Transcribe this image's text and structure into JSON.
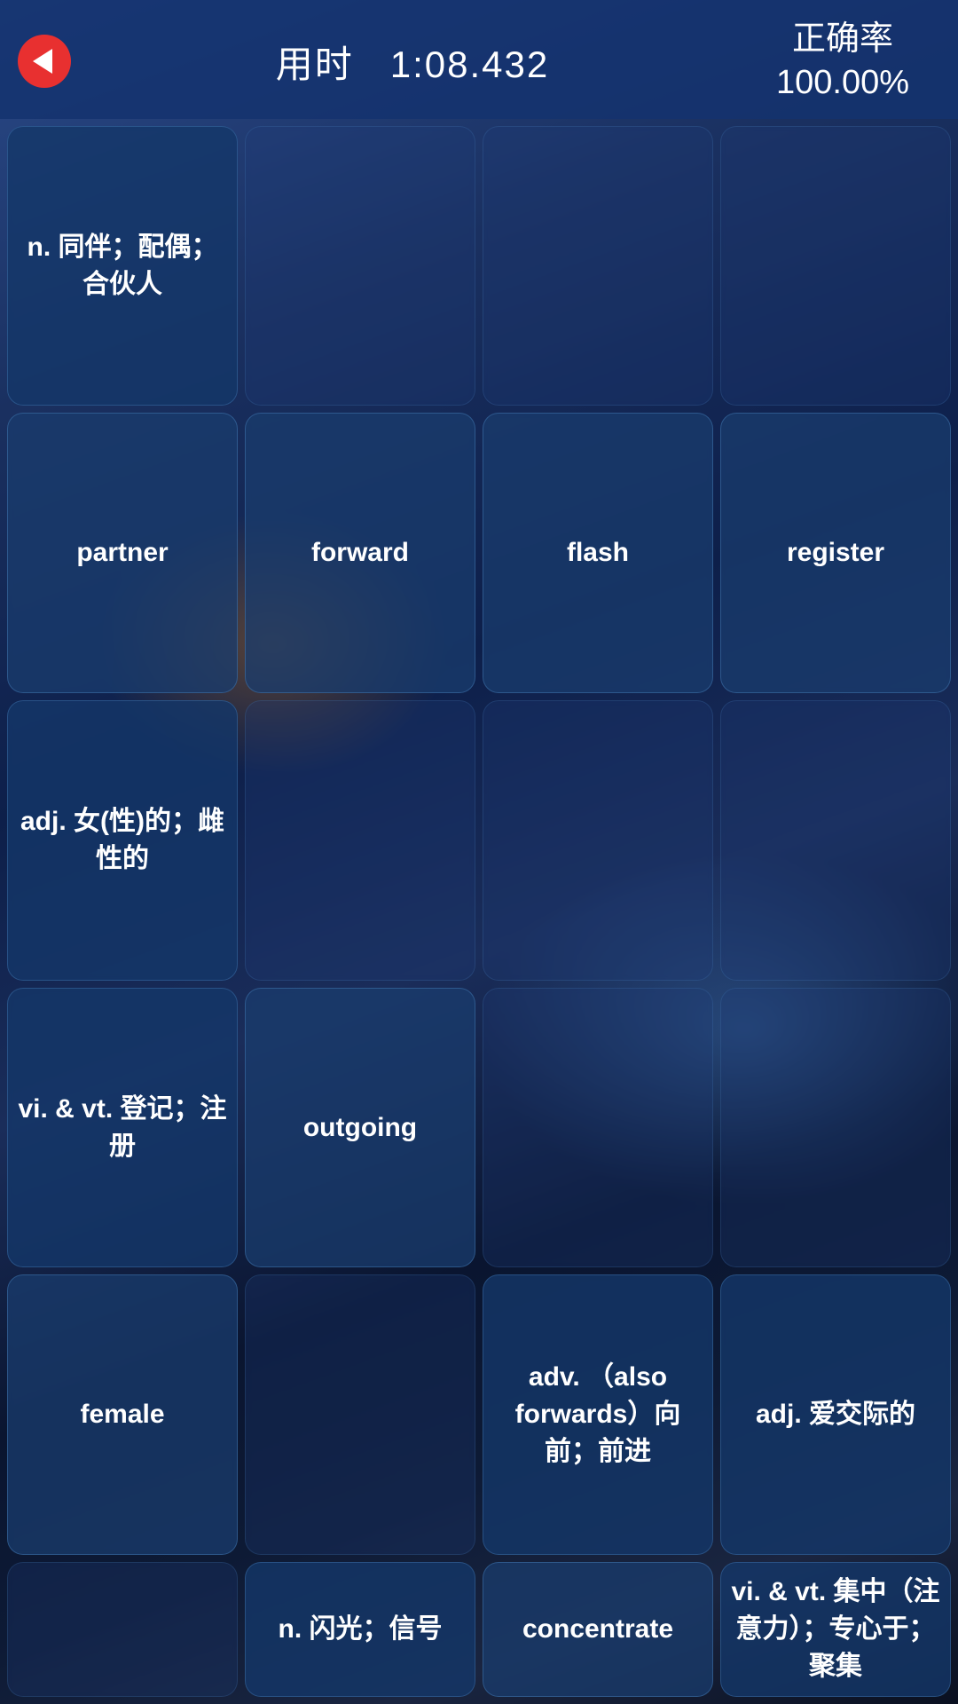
{
  "header": {
    "back_label": "←",
    "timer_prefix": "用时",
    "timer_value": "1:08.432",
    "accuracy_label": "正确率",
    "accuracy_value": "100.00%"
  },
  "grid": [
    {
      "id": "r0c0",
      "text": "n. 同伴；配偶；合伙人",
      "type": "definition"
    },
    {
      "id": "r0c1",
      "text": "",
      "type": "empty"
    },
    {
      "id": "r0c2",
      "text": "",
      "type": "empty"
    },
    {
      "id": "r0c3",
      "text": "",
      "type": "empty"
    },
    {
      "id": "r1c0",
      "text": "partner",
      "type": "word"
    },
    {
      "id": "r1c1",
      "text": "forward",
      "type": "word"
    },
    {
      "id": "r1c2",
      "text": "flash",
      "type": "word"
    },
    {
      "id": "r1c3",
      "text": "register",
      "type": "word"
    },
    {
      "id": "r2c0",
      "text": "adj. 女(性)的；雌性的",
      "type": "definition"
    },
    {
      "id": "r2c1",
      "text": "",
      "type": "empty"
    },
    {
      "id": "r2c2",
      "text": "",
      "type": "empty"
    },
    {
      "id": "r2c3",
      "text": "",
      "type": "empty"
    },
    {
      "id": "r3c0",
      "text": "vi. & vt. 登记；注册",
      "type": "definition"
    },
    {
      "id": "r3c1",
      "text": "outgoing",
      "type": "word"
    },
    {
      "id": "r3c2",
      "text": "",
      "type": "empty"
    },
    {
      "id": "r3c3",
      "text": "",
      "type": "empty"
    },
    {
      "id": "r4c0",
      "text": "female",
      "type": "word"
    },
    {
      "id": "r4c1",
      "text": "",
      "type": "empty"
    },
    {
      "id": "r4c2",
      "text": "adv. （also forwards）向前；前进",
      "type": "definition"
    },
    {
      "id": "r4c3",
      "text": "adj. 爱交际的",
      "type": "definition"
    },
    {
      "id": "r5c0",
      "text": "",
      "type": "empty"
    },
    {
      "id": "r5c1",
      "text": "n. 闪光；信号",
      "type": "definition"
    },
    {
      "id": "r5c2",
      "text": "concentrate",
      "type": "word"
    },
    {
      "id": "r5c3",
      "text": "vi. & vt. 集中（注意力）；专心于；聚集",
      "type": "definition"
    }
  ]
}
